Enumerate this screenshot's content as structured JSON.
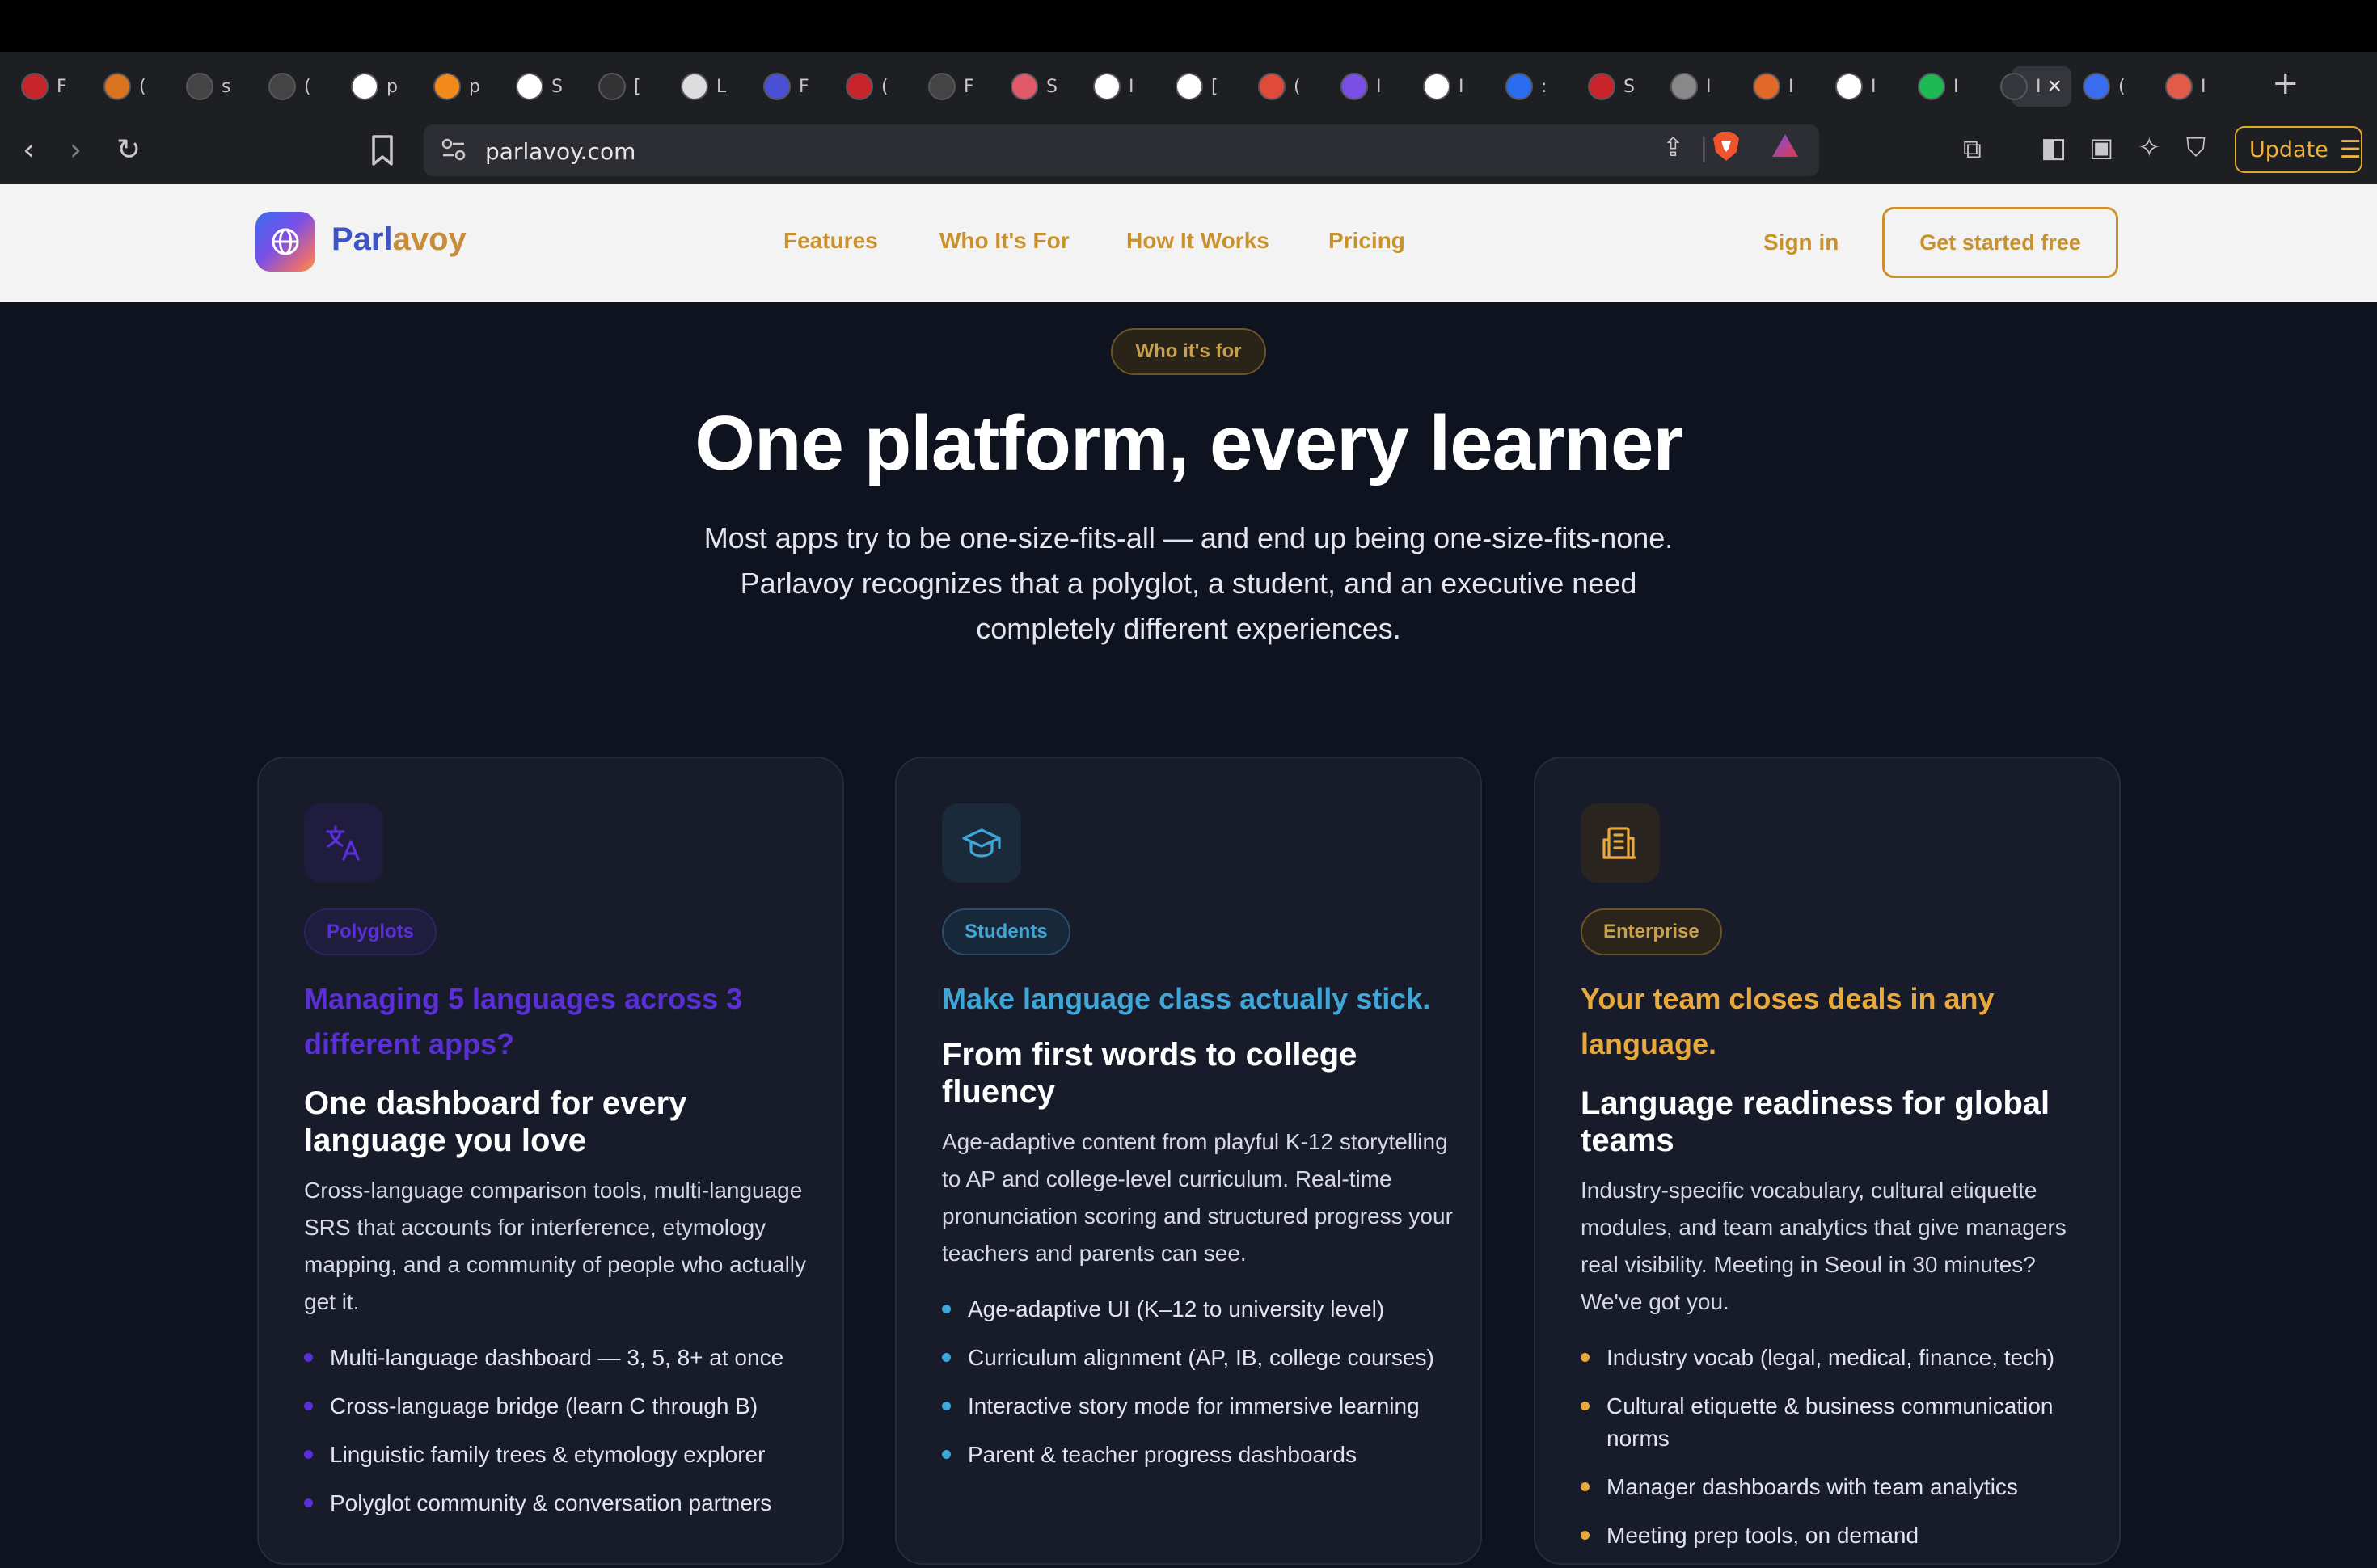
{
  "browser": {
    "tabs": [
      {
        "initial": "F",
        "color": "#c8242c"
      },
      {
        "initial": "(",
        "color": "#d9731f"
      },
      {
        "initial": "s",
        "color": "#444444"
      },
      {
        "initial": "(",
        "color": "#444444"
      },
      {
        "initial": "p",
        "color": "#ffffff"
      },
      {
        "initial": "p",
        "color": "#f28a1a"
      },
      {
        "initial": "S",
        "color": "#ffffff"
      },
      {
        "initial": "[",
        "color": "#333333"
      },
      {
        "initial": "L",
        "color": "#dddddd"
      },
      {
        "initial": "F",
        "color": "#4a4fd6"
      },
      {
        "initial": "(",
        "color": "#c8242c"
      },
      {
        "initial": "F",
        "color": "#444444"
      },
      {
        "initial": "S",
        "color": "#e25a6a"
      },
      {
        "initial": "I",
        "color": "#ffffff"
      },
      {
        "initial": "[",
        "color": "#ffffff"
      },
      {
        "initial": "(",
        "color": "#e04a3a"
      },
      {
        "initial": "I",
        "color": "#7a4fe6"
      },
      {
        "initial": "I",
        "color": "#ffffff"
      },
      {
        "initial": ":",
        "color": "#2a6cf0"
      },
      {
        "initial": "S",
        "color": "#c8242c"
      },
      {
        "initial": "I",
        "color": "#888888"
      },
      {
        "initial": "I",
        "color": "#e2682a"
      },
      {
        "initial": "I",
        "color": "#ffffff"
      },
      {
        "initial": "I",
        "color": "#1db954"
      },
      {
        "initial": "I",
        "color": "#35363b"
      },
      {
        "initial": "(",
        "color": "#3a6cf0"
      },
      {
        "initial": "I",
        "color": "#e25a4a"
      }
    ],
    "active_tab_initial": "I",
    "url": "parlavoy.com",
    "update_label": "Update"
  },
  "nav": {
    "logo_part1": "Parl",
    "logo_part2": "avoy",
    "links": [
      "Features",
      "Who It's For",
      "How It Works",
      "Pricing"
    ],
    "signin": "Sign in",
    "cta": "Get started free"
  },
  "hero": {
    "eyebrow": "Who it's for",
    "title": "One platform, every learner",
    "subtitle": "Most apps try to be one-size-fits-all — and end up being one-size-fits-none. Parlavoy recognizes that a polyglot, a student, and an executive need completely different experiences."
  },
  "cards": [
    {
      "icon": "translate-icon",
      "accent": "#5a2fd8",
      "icon_bg": "#1f1c3d",
      "badge_bg": "#1f1c3d",
      "badge_border": "#2c2460",
      "badge": "Polyglots",
      "hook": "Managing 5 languages across 3 different apps?",
      "title": "One dashboard for every language you love",
      "body": "Cross-language comparison tools, multi-language SRS that accounts for interference, etymology mapping, and a community of people who actually get it.",
      "bullets": [
        "Multi-language dashboard — 3, 5, 8+ at once",
        "Cross-language bridge (learn C through B)",
        "Linguistic family trees & etymology explorer",
        "Polyglot community & conversation partners"
      ]
    },
    {
      "icon": "graduation-cap-icon",
      "accent": "#3fa6d8",
      "icon_bg": "#1a2a3a",
      "badge_bg": "#17283a",
      "badge_border": "#2a4e6a",
      "badge": "Students",
      "hook": "Make language class actually stick.",
      "title": "From first words to college fluency",
      "body": "Age-adaptive content from playful K-12 storytelling to AP and college-level curriculum. Real-time pronunciation scoring and structured progress your teachers and parents can see.",
      "bullets": [
        "Age-adaptive UI (K–12 to university level)",
        "Curriculum alignment (AP, IB, college courses)",
        "Interactive story mode for immersive learning",
        "Parent & teacher progress dashboards"
      ]
    },
    {
      "icon": "building-icon",
      "accent": "#e8a93a",
      "icon_bg": "#2a2520",
      "badge_bg": "#2a241a",
      "badge_border": "#6b5426",
      "badge": "Enterprise",
      "hook": "Your team closes deals in any language.",
      "title": "Language readiness for global teams",
      "body": "Industry-specific vocabulary, cultural etiquette modules, and team analytics that give managers real visibility. Meeting in Seoul in 30 minutes? We've got you.",
      "bullets": [
        "Industry vocab (legal, medical, finance, tech)",
        "Cultural etiquette & business communication norms",
        "Manager dashboards with team analytics",
        "Meeting prep tools, on demand"
      ]
    }
  ]
}
